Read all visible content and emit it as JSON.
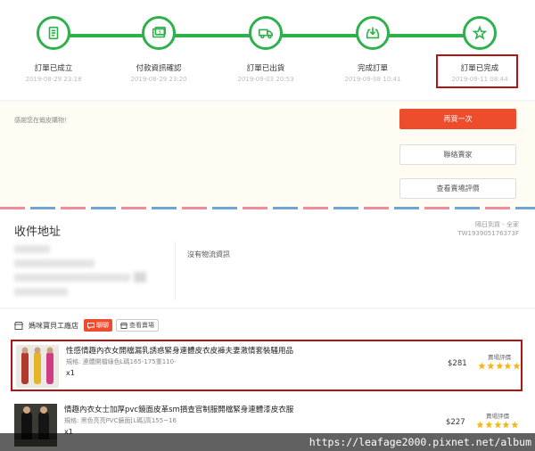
{
  "tracker": {
    "steps": [
      {
        "label": "訂單已成立",
        "time": "2019-08-29 23:18",
        "icon": "receipt-icon"
      },
      {
        "label": "付款資訊確認",
        "time": "2019-08-29 23:20",
        "icon": "payment-icon"
      },
      {
        "label": "訂單已出貨",
        "time": "2019-09-03 20:53",
        "icon": "truck-icon"
      },
      {
        "label": "完成訂單",
        "time": "2019-09-08 10:41",
        "icon": "inbox-download-icon"
      },
      {
        "label": "訂單已完成",
        "time": "2019-09-11 08:44",
        "icon": "star-icon"
      }
    ],
    "color": "#2db14a"
  },
  "actions": {
    "notice": "感謝您在蝦皮購物！",
    "buy_again": "再買一次",
    "contact_seller": "聯絡賣家",
    "view_shop_review": "查看賣場評價",
    "accent": "#ee4d2d"
  },
  "address": {
    "title": "收件地址",
    "carrier": "隔日到貨 - 全家",
    "tracking_no": "TW193905176373F",
    "no_logistics": "沒有物流資訊"
  },
  "shop": {
    "name": "媽咪寶貝工廠店",
    "chat_label": "聊聊",
    "view_shop_label": "查看賣場",
    "review_label": "賣場評價",
    "items": [
      {
        "title": "性感情趣內衣女開檔漏乳誘惑緊身連體皮衣皮褲夫妻激情套裝騷用品",
        "spec": "規格: 連體開檔綠色L碼165-175重110-",
        "qty": "x1",
        "price": "$281",
        "rating": 5
      },
      {
        "title": "情趣內衣女士加厚pvc鏡面皮革sm損查官制服開檔緊身連體漆皮衣服",
        "spec": "規格: 黑色亮亮PVC鏡面[L碼]高155~16",
        "qty": "x1",
        "price": "$227",
        "rating": 5
      }
    ]
  },
  "watermark": "https://leafage2000.pixnet.net/album"
}
